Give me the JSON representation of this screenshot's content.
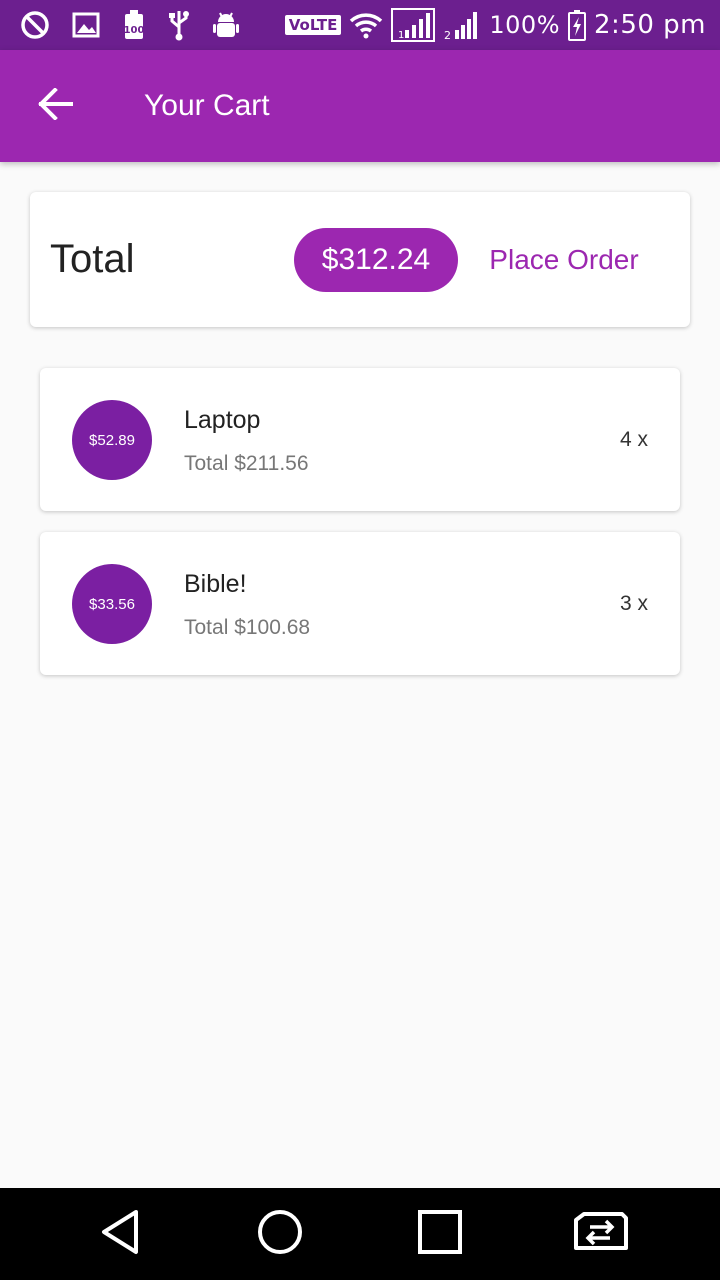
{
  "status_bar": {
    "volte": "VoLTE",
    "battery_percent": "100%",
    "time": "2:50 pm",
    "icons": [
      "block-icon",
      "image-icon",
      "battery-saver-icon",
      "usb-icon",
      "android-debug-icon",
      "wifi-icon",
      "signal-sim1-icon",
      "signal-sim2-icon",
      "battery-charging-icon"
    ]
  },
  "app_bar": {
    "title": "Your Cart",
    "back_icon": "arrow-back-icon",
    "color": "#9c27b0"
  },
  "total_card": {
    "label": "Total",
    "amount": "$312.24",
    "action": "Place Order"
  },
  "items": [
    {
      "price": "$52.89",
      "name": "Laptop",
      "total": "Total $211.56",
      "quantity": "4 x"
    },
    {
      "price": "$33.56",
      "name": "Bible!",
      "total": "Total $100.68",
      "quantity": "3 x"
    }
  ],
  "nav_bar": {
    "icons": [
      "back-triangle-icon",
      "home-circle-icon",
      "recents-square-icon",
      "switch-sim-icon"
    ]
  },
  "colors": {
    "accent": "#9c27b0",
    "status_bar": "#6c1f8f",
    "avatar": "#7b1fa2"
  }
}
